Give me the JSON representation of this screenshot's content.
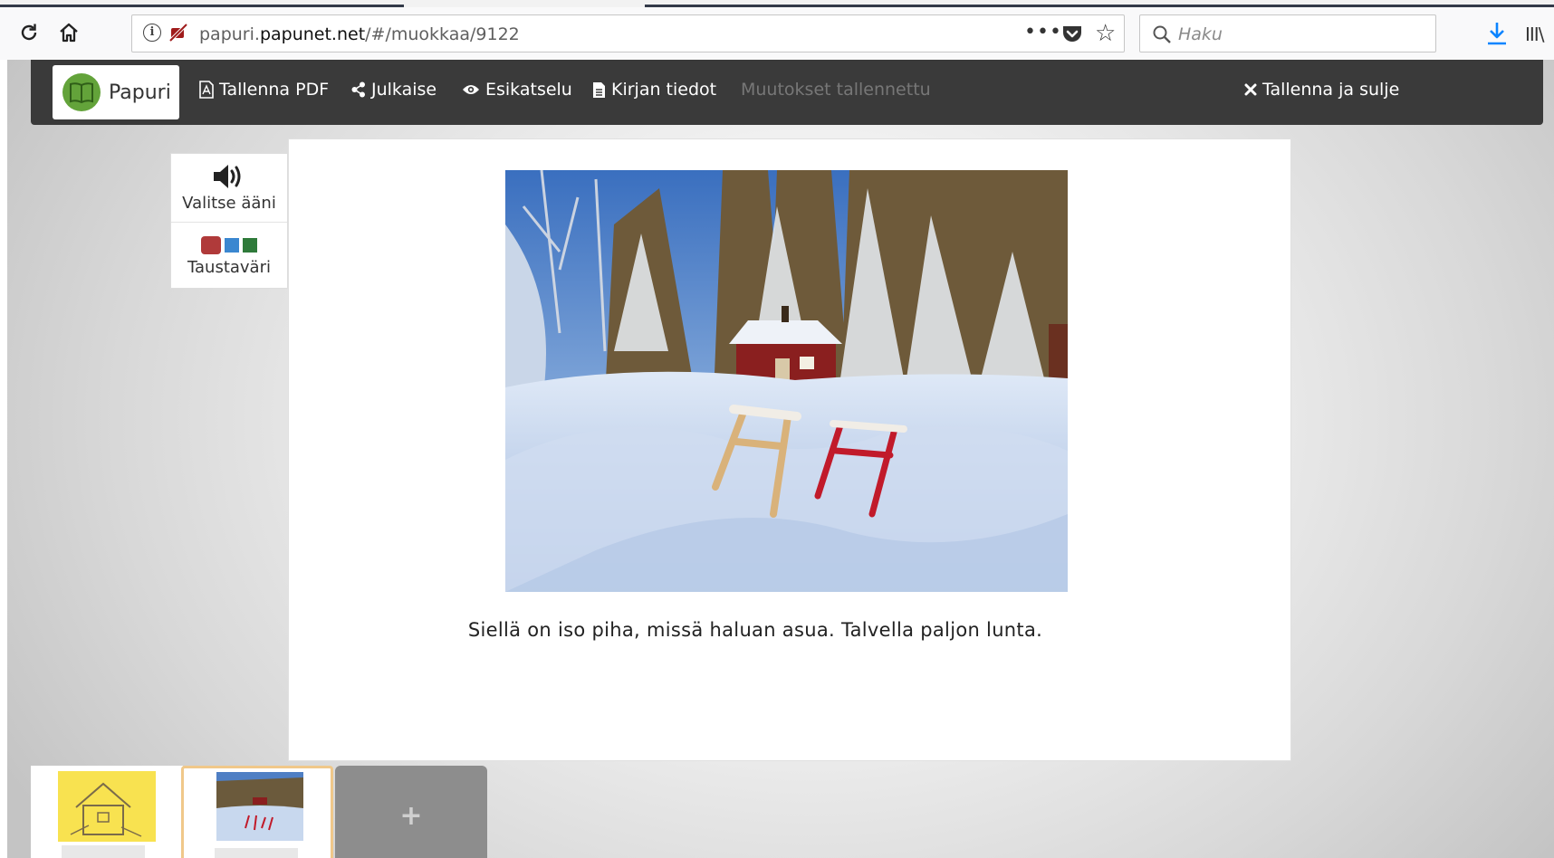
{
  "browser": {
    "url_prefix": "papuri.",
    "url_domain": "papunet.net",
    "url_path": "/#/muokkaa/9122",
    "more_label": "•••",
    "search_placeholder": "Haku",
    "library_label": "III\\"
  },
  "app": {
    "brand": "Papuri",
    "buttons": {
      "save_pdf": "Tallenna PDF",
      "publish": "Julkaise",
      "preview": "Esikatselu",
      "book_info": "Kirjan tiedot",
      "status": "Muutokset tallennettu",
      "save_close": "Tallenna ja sulje"
    }
  },
  "side_tools": {
    "sound_label": "Valitse ääni",
    "bg_label": "Taustaväri",
    "bg_colors": [
      "#b03a3a",
      "#3b87d0",
      "#2f7a3a"
    ]
  },
  "page": {
    "caption": "Siellä on iso piha, missä haluan asua. Talvella paljon lunta."
  },
  "thumbnails": {
    "add_label": "+"
  },
  "colors": {
    "appbar": "#3a3a3a",
    "brand_green": "#63a33a",
    "selected_thumb_border": "#f0c88a",
    "download_blue": "#0a84ff"
  }
}
